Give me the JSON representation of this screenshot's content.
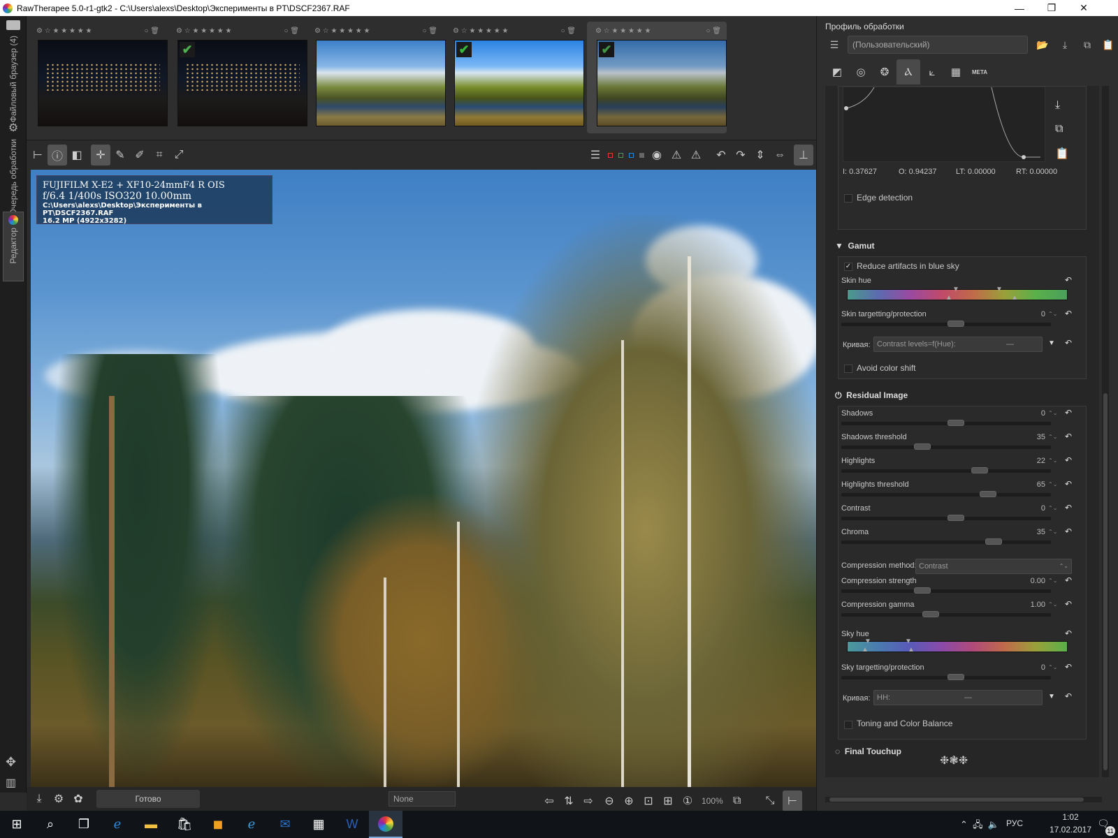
{
  "window": {
    "title": "RawTherapee 5.0-r1-gtk2 - C:\\Users\\alexs\\Desktop\\Эксперименты в PT\\DSCF2367.RAF",
    "minimize": "—",
    "maximize": "❐",
    "close": "✕"
  },
  "left_tabs": {
    "file_browser": "Файловый браузер (4)",
    "queue": "Очередь обработки",
    "editor": "Редактор"
  },
  "thumb_bar": {
    "stars": "☆ ★ ★ ★ ★ ★",
    "check": "✔"
  },
  "image_info": {
    "line1": "FUJIFILM X-E2 + XF10-24mmF4 R OIS",
    "line2": "f/6.4  1/400s  ISO320  10.00mm",
    "line3": "C:\\Users\\alexs\\Desktop\\Эксперименты в PT\\DSCF2367.RAF",
    "line4": "16.2 MP (4922x3282)"
  },
  "status": {
    "text": "Готово",
    "filter": "None",
    "zoom": "100%"
  },
  "right_panel": {
    "header": "Профиль обработки",
    "profile": "(Пользовательский)",
    "curve_readout": {
      "i": "I: 0.37627",
      "o": "O: 0.94237",
      "lt": "LT: 0.00000",
      "rt": "RT: 0.00000"
    },
    "edge_detection": "Edge detection",
    "gamut": {
      "title": "Gamut",
      "reduce": "Reduce artifacts in blue sky",
      "skin_hue": "Skin hue",
      "skin_target": "Skin targetting/protection",
      "skin_target_val": "0",
      "curve_label": "Кривая:",
      "curve_combo": "Contrast levels=f(Hue):",
      "avoid": "Avoid color shift"
    },
    "residual": {
      "title": "Residual Image",
      "sliders": [
        {
          "label": "Shadows",
          "value": "0"
        },
        {
          "label": "Shadows threshold",
          "value": "35"
        },
        {
          "label": "Highlights",
          "value": "22"
        },
        {
          "label": "Highlights threshold",
          "value": "65"
        },
        {
          "label": "Contrast",
          "value": "0"
        },
        {
          "label": "Chroma",
          "value": "35"
        }
      ],
      "compression_method_label": "Compression method:",
      "compression_method": "Contrast",
      "compression_strength": "Compression strength",
      "compression_strength_val": "0.00",
      "compression_gamma": "Compression gamma",
      "compression_gamma_val": "1.00",
      "sky_hue": "Sky hue",
      "sky_target": "Sky targetting/protection",
      "sky_target_val": "0",
      "curve_label": "Кривая:",
      "curve_combo": "HH:",
      "toning": "Toning and Color Balance"
    },
    "final": "Final Touchup",
    "meta_tab": "META"
  },
  "taskbar": {
    "lang": "РУС",
    "time": "1:02",
    "date": "17.02.2017",
    "notif": "11"
  }
}
